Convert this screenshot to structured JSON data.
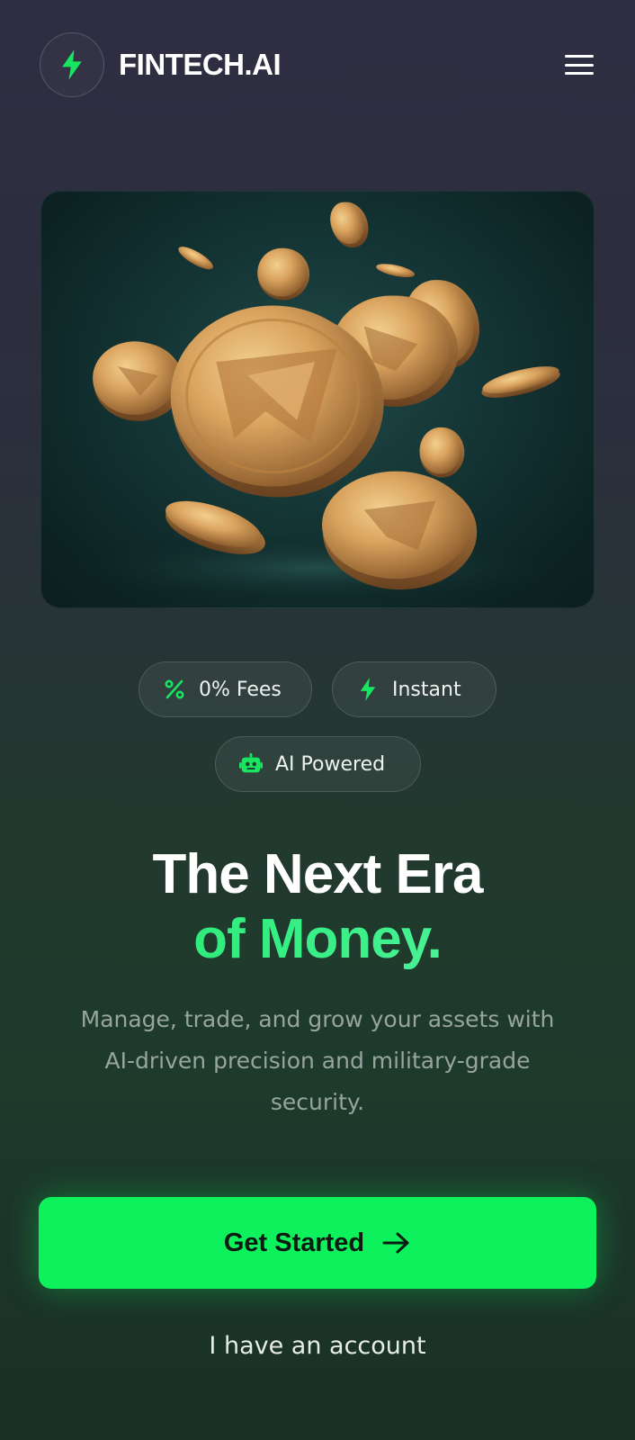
{
  "header": {
    "brand_name": "FINTECH.AI",
    "logo_icon": "bolt-icon",
    "menu_icon": "hamburger-menu-icon"
  },
  "hero": {
    "image": "floating-gold-coins-illustration"
  },
  "badges": [
    {
      "label": "0% Fees",
      "icon": "percent-icon"
    },
    {
      "label": "Instant",
      "icon": "bolt-icon"
    },
    {
      "label": "AI Powered",
      "icon": "robot-icon"
    }
  ],
  "headline": {
    "line1": "The Next Era",
    "line2": "of Money."
  },
  "subtitle": "Manage, trade, and grow your assets with AI-driven precision and military-grade security.",
  "cta": {
    "primary_label": "Get Started",
    "primary_icon": "arrow-right-icon",
    "secondary_label": "I have an account"
  },
  "colors": {
    "accent": "#0df25c",
    "background_top": "#2e2d42",
    "background_bottom": "#1a2f26"
  }
}
